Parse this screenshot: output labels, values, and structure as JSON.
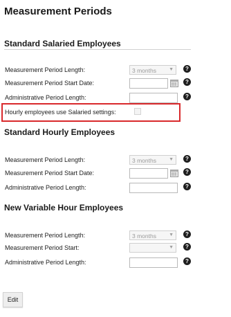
{
  "page": {
    "title": "Measurement Periods"
  },
  "salaried": {
    "title": "Standard Salaried Employees",
    "period_length_label": "Measurement Period Length:",
    "period_length_value": "3 months",
    "start_date_label": "Measurement Period Start Date:",
    "admin_length_label": "Administrative Period Length:",
    "hourly_use_label": "Hourly employees use Salaried settings:",
    "highlight_color": "#d9282b"
  },
  "hourly": {
    "title": "Standard Hourly Employees",
    "period_length_label": "Measurement Period Length:",
    "period_length_value": "3 months",
    "start_date_label": "Measurement Period Start Date:",
    "admin_length_label": "Administrative Period Length:"
  },
  "variable": {
    "title": "New Variable Hour Employees",
    "period_length_label": "Measurement Period Length:",
    "period_length_value": "3 months",
    "start_label": "Measurement Period Start:",
    "start_value": "",
    "admin_length_label": "Administrative Period Length:"
  },
  "help_glyph": "?",
  "icons": {
    "help": "question-circle-icon",
    "calendar": "calendar-icon",
    "dropdown": "chevron-down-icon"
  },
  "actions": {
    "edit_label": "Edit"
  }
}
